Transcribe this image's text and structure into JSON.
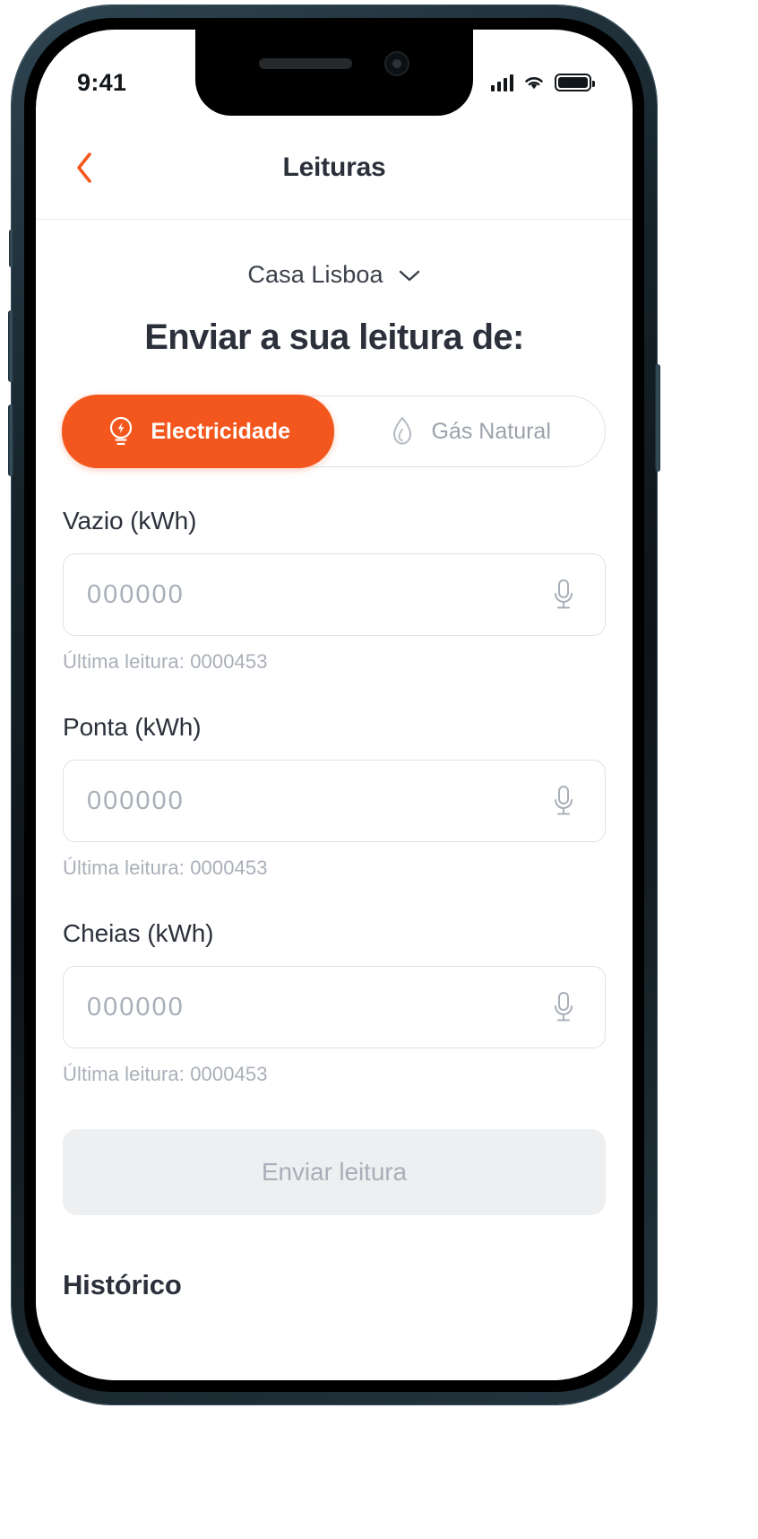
{
  "status_bar": {
    "time": "9:41",
    "signal_icon": "cellular-signal-icon",
    "wifi_icon": "wifi-icon",
    "battery_icon": "battery-icon"
  },
  "header": {
    "back_icon": "chevron-left-icon",
    "title": "Leituras"
  },
  "account": {
    "name": "Casa Lisboa",
    "chevron_icon": "chevron-down-icon"
  },
  "section": {
    "heading": "Enviar a sua leitura de:"
  },
  "energy_toggle": {
    "tabs": [
      {
        "label": "Electricidade",
        "icon": "lightbulb-icon",
        "active": true
      },
      {
        "label": "Gás Natural",
        "icon": "flame-icon",
        "active": false
      }
    ]
  },
  "readings": [
    {
      "label": "Vazio (kWh)",
      "value": "",
      "placeholder": "000000",
      "hint": "Última leitura: 0000453",
      "mic_icon": "microphone-icon"
    },
    {
      "label": "Ponta (kWh)",
      "value": "",
      "placeholder": "000000",
      "hint": "Última leitura: 0000453",
      "mic_icon": "microphone-icon"
    },
    {
      "label": "Cheias (kWh)",
      "value": "",
      "placeholder": "000000",
      "hint": "Última leitura: 0000453",
      "mic_icon": "microphone-icon"
    }
  ],
  "submit": {
    "label": "Enviar leitura",
    "enabled": false
  },
  "history": {
    "heading": "Histórico"
  },
  "colors": {
    "accent": "#f4571d",
    "text_primary": "#2b303b",
    "text_muted": "#a9afb8",
    "border": "#dfe2e6",
    "disabled_bg": "#eeeff1"
  }
}
